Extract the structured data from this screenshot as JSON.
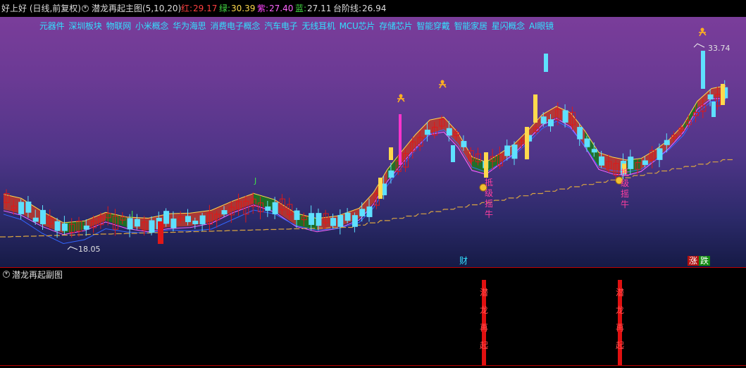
{
  "header": {
    "stock_title": "好上好 (日线,前复权)",
    "indicator_name": "潜龙再起主图(5,10,20)",
    "red_label": "红:",
    "red_value": "29.17",
    "green_label": "绿:",
    "green_value": "30.39",
    "purple_label": "紫:",
    "purple_value": "27.40",
    "blue_label": "蓝:",
    "blue_value": "27.11",
    "step_label": "台阶线:",
    "step_value": "26.94"
  },
  "concepts": [
    "元器件",
    "深圳板块",
    "物联网",
    "小米概念",
    "华为海思",
    "消费电子概念",
    "汽车电子",
    "无线耳机",
    "MCU芯片",
    "存储芯片",
    "智能穿戴",
    "智能家居",
    "星闪概念",
    "AI眼镜"
  ],
  "annotations": {
    "high_price": "33.74",
    "low_price": "18.05",
    "j_label": "J",
    "signal_text": "抵级摇牛",
    "finance_tag": "财",
    "rise_tag": "涨",
    "fall_tag": "跌"
  },
  "sub_chart": {
    "title": "潜龙再起副图",
    "signal_chars": [
      "潜",
      "龙",
      "再",
      "起"
    ]
  },
  "colors": {
    "up_candle": "#e01818",
    "down_candle": "#5ee0ff",
    "ma5": "#ffd94d",
    "ma10": "#ff66ff",
    "ma20": "#3366ff",
    "band_up": "#c0392b",
    "band_down": "#1a7a1a",
    "step_line": "#d9a441",
    "signal_bar": "#e01010",
    "concept_text": "#33e0ff"
  }
}
